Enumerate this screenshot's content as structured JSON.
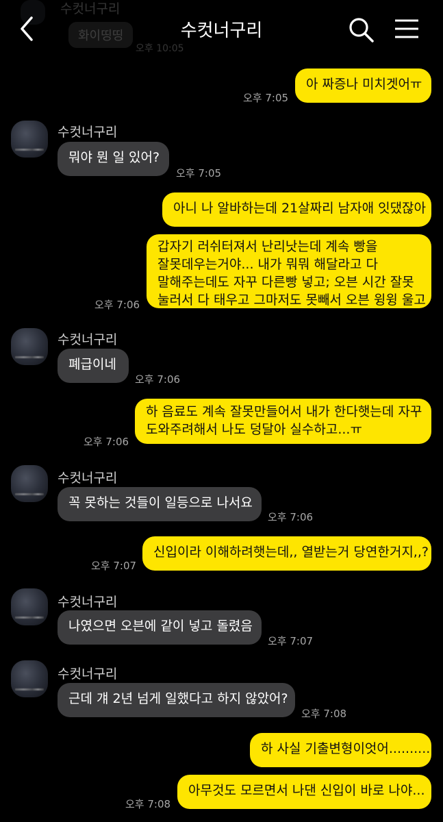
{
  "header": {
    "title": "수컷너구리"
  },
  "ghost": {
    "sender": "수컷너구리",
    "message": "화이띵띵",
    "time": "오후 10:05"
  },
  "messages": [
    {
      "side": "out",
      "text": "아 짜증나 미치겟어ㅠ",
      "time": "오후 7:05"
    },
    {
      "side": "in",
      "sender": "수컷너구리",
      "text": "뭐야 뭔 일 있어?",
      "time": "오후 7:05"
    },
    {
      "side": "out",
      "text": "아니 나 알바하는데 21살짜리 남자애 잇댔잖아"
    },
    {
      "side": "out",
      "text": "갑자기 러쉬터져서 난리낫는데 계속 빵을\n잘못데우는거야... 내가 뭐뭐 해달라고 다\n말해주는데도 자꾸 다른빵 넣고; 오븐 시간 잘못\n눌러서 다 태우고 그마저도 못빼서 오븐 윙윙 울고",
      "time": "오후 7:06"
    },
    {
      "side": "in",
      "sender": "수컷너구리",
      "text": "폐급이네",
      "time": "오후 7:06"
    },
    {
      "side": "out",
      "text": "하 음료도 계속 잘못만들어서 내가 한다햇는데 자꾸\n도와주려해서 나도 덩달아 실수하고...ㅠ",
      "time": "오후 7:06"
    },
    {
      "side": "in",
      "sender": "수컷너구리",
      "text": "꼭 못하는 것들이 일등으로 나서요",
      "time": "오후 7:06"
    },
    {
      "side": "out",
      "text": "신입이라 이해하려햇는데,, 열받는거 당연한거지,,?",
      "time": "오후 7:07"
    },
    {
      "side": "in",
      "sender": "수컷너구리",
      "text": "나였으면 오븐에 같이 넣고 돌렸음",
      "time": "오후 7:07"
    },
    {
      "side": "in",
      "sender": "수컷너구리",
      "text": "근데 걔 2년 넘게 일했다고 하지 않았어?",
      "time": "오후 7:08"
    },
    {
      "side": "out",
      "text": "하 사실 기출변형이엇어.........."
    },
    {
      "side": "out",
      "text": "아무것도 모르면서 나댄 신입이 바로 나야...",
      "time": "오후 7:08"
    }
  ],
  "colors": {
    "background": "#000000",
    "incoming_bubble": "#3c3c3e",
    "outgoing_bubble": "#fee500"
  },
  "icons": [
    "back-arrow-icon",
    "search-icon",
    "menu-icon"
  ]
}
